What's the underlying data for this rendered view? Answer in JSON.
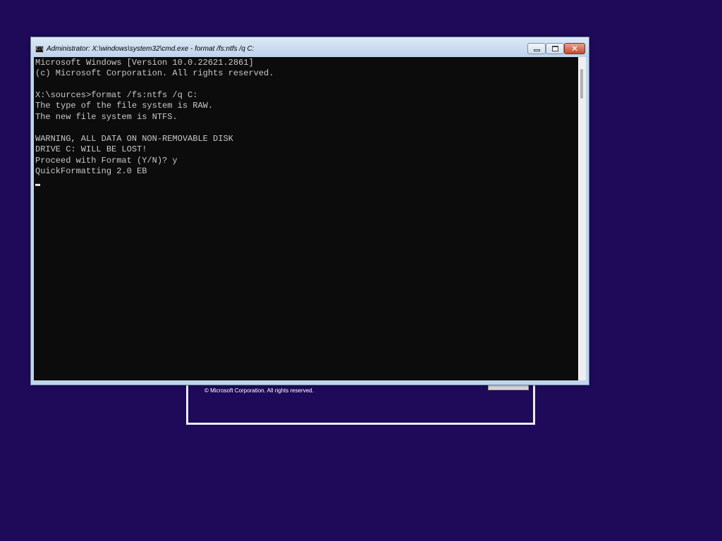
{
  "window": {
    "title": "Administrator: X:\\windows\\system32\\cmd.exe - format  /fs:ntfs /q C:",
    "icon_text": "C:\\",
    "close_symbol": "✕"
  },
  "console": {
    "lines": [
      "Microsoft Windows [Version 10.0.22621.2861]",
      "(c) Microsoft Corporation. All rights reserved.",
      "",
      "X:\\sources>format /fs:ntfs /q C:",
      "The type of the file system is RAW.",
      "The new file system is NTFS.",
      "",
      "WARNING, ALL DATA ON NON-REMOVABLE DISK",
      "DRIVE C: WILL BE LOST!",
      "Proceed with Format (Y/N)? y",
      "QuickFormatting 2.0 EB"
    ],
    "background": "#0c0c0c",
    "text_color": "#c8c8c8"
  },
  "setup": {
    "copyright": "© Microsoft Corporation. All rights reserved."
  },
  "colors": {
    "desktop": "#1e0a58",
    "titlebar": "#bdd3ec",
    "close_button": "#c74a31"
  }
}
